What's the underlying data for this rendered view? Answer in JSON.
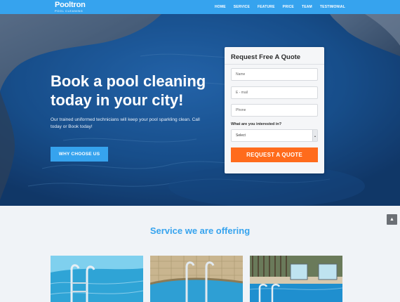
{
  "header": {
    "brand": "Pooltron",
    "tagline": "POOL CLEANING",
    "nav": [
      "HOME",
      "SERVICE",
      "FEATURE",
      "PRICE",
      "TEAM",
      "TESTIMONIAL"
    ]
  },
  "hero": {
    "title": "Book a pool cleaning today in your city!",
    "description": "Our trained uniformed technicians will keep your pool sparkling clean. Call today or Book today!",
    "button": "WHY CHOOSE US"
  },
  "quote_form": {
    "title": "Request Free A Quote",
    "name_placeholder": "Name",
    "email_placeholder": "E - mail",
    "phone_placeholder": "Phone",
    "select_label": "What are you interested in?",
    "select_value": "Select",
    "submit": "REQUEST A QUOTE"
  },
  "services": {
    "title": "Service we are offering"
  },
  "colors": {
    "accent": "#36a3ee",
    "cta": "#ff6b1c"
  },
  "icons": {
    "scroll_top": "chevron-up-icon"
  }
}
